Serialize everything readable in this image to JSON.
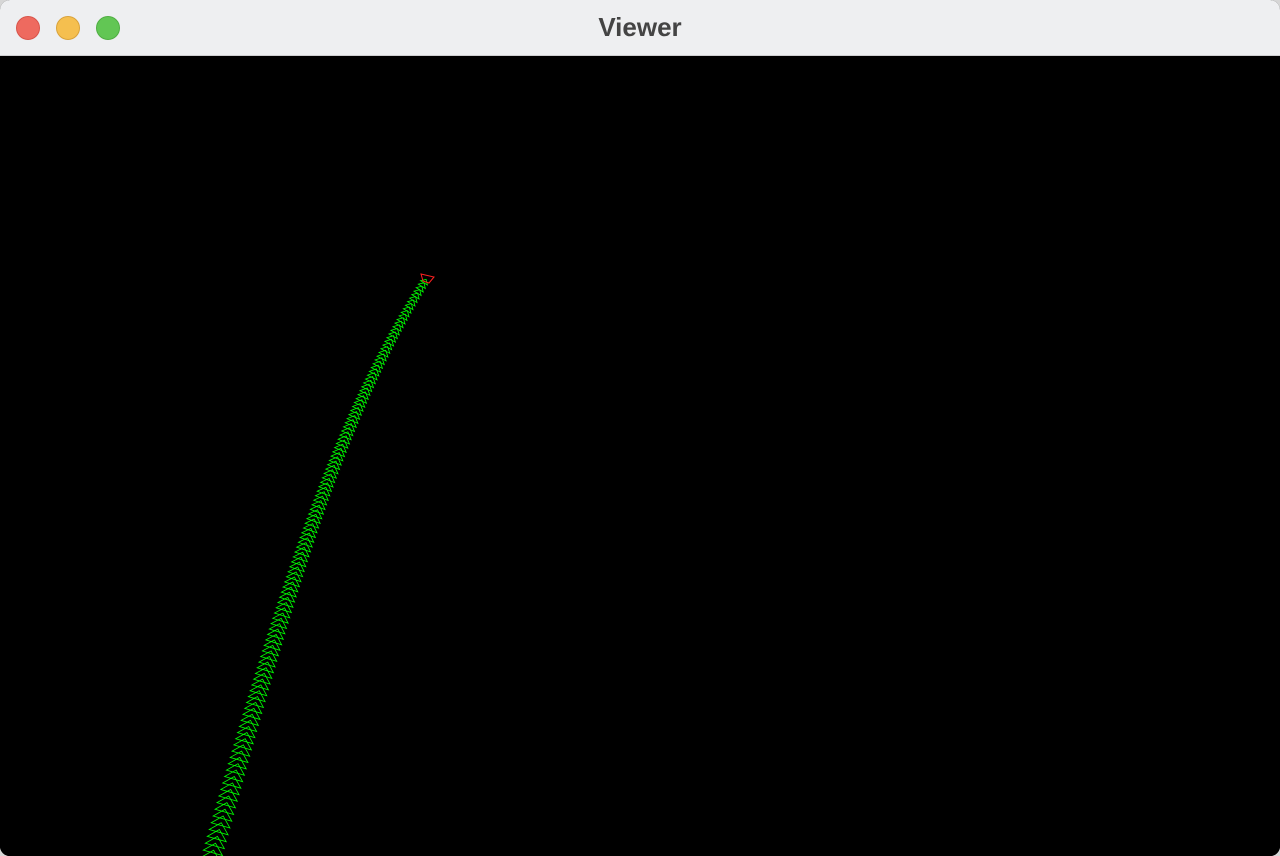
{
  "window": {
    "title": "Viewer"
  },
  "scene": {
    "background_color": "#000000",
    "trajectory_color": "#00ff00",
    "current_pose_color": "#ff2020"
  }
}
